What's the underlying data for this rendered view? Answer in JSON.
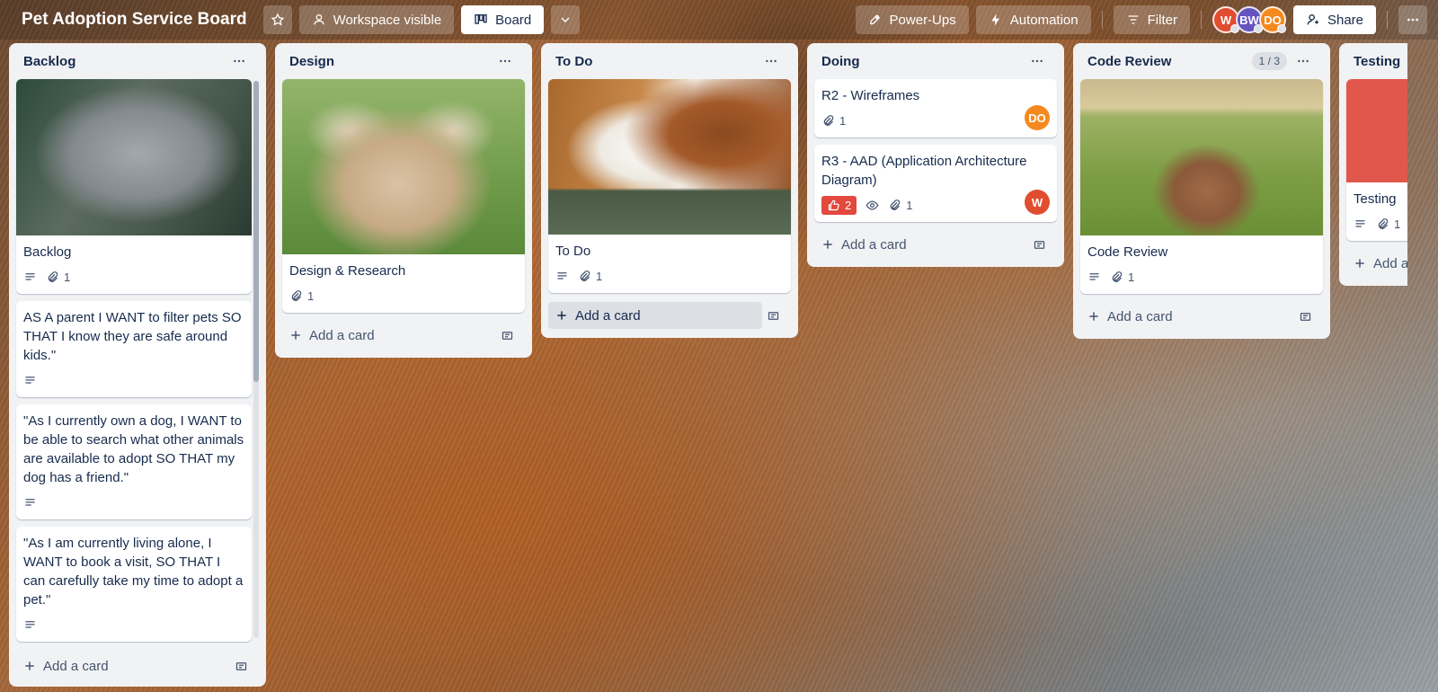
{
  "header": {
    "board_title": "Pet Adoption Service Board",
    "visibility_label": "Workspace visible",
    "view_label": "Board",
    "powerups_label": "Power-Ups",
    "automation_label": "Automation",
    "filter_label": "Filter",
    "share_label": "Share",
    "members": [
      {
        "initials": "W",
        "color": "#e04d2f"
      },
      {
        "initials": "BW",
        "color": "#6554c0"
      },
      {
        "initials": "DO",
        "color": "#f5891f"
      }
    ]
  },
  "lists": {
    "backlog": {
      "title": "Backlog",
      "add_label": "Add a card",
      "cards": [
        {
          "title": "Backlog",
          "attachments": "1"
        },
        {
          "title": "AS A parent I WANT to filter pets SO THAT I know they are safe around kids.\""
        },
        {
          "title": "\"As I currently own a dog, I WANT to be able to search what other animals are available to adopt SO THAT my dog has a friend.\""
        },
        {
          "title": "\"As I am currently living alone, I WANT to book a visit, SO THAT I can carefully take my time to adopt a pet.\""
        }
      ]
    },
    "design": {
      "title": "Design",
      "add_label": "Add a card",
      "cards": [
        {
          "title": "Design & Research",
          "attachments": "1"
        }
      ]
    },
    "todo": {
      "title": "To Do",
      "add_label": "Add a card",
      "cards": [
        {
          "title": "To Do",
          "attachments": "1"
        }
      ]
    },
    "doing": {
      "title": "Doing",
      "add_label": "Add a card",
      "cards": [
        {
          "title": "R2 - Wireframes",
          "attachments": "1",
          "member": "DO",
          "member_color": "#f5891f"
        },
        {
          "title": "R3 - AAD (Application Architecture Diagram)",
          "votes": "2",
          "attachments": "1",
          "member": "W",
          "member_color": "#e04d2f"
        }
      ]
    },
    "code_review": {
      "title": "Code Review",
      "count": "1 / 3",
      "add_label": "Add a card",
      "cards": [
        {
          "title": "Code Review",
          "attachments": "1"
        }
      ]
    },
    "testing": {
      "title": "Testing",
      "add_label": "Add a c",
      "cards": [
        {
          "title": "Testing",
          "attachments": "1"
        }
      ]
    }
  }
}
